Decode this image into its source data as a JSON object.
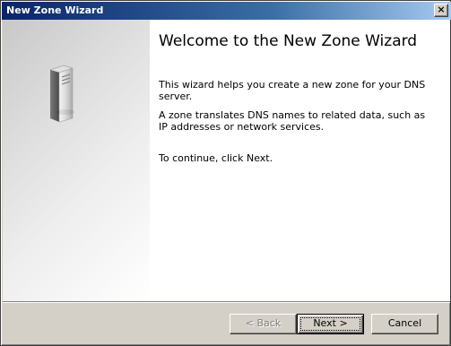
{
  "window": {
    "title": "New Zone Wizard",
    "close_glyph": "×"
  },
  "wizard": {
    "heading": "Welcome to the New Zone Wizard",
    "paragraphs": [
      "This wizard helps you create a new zone for your DNS server.",
      "A zone translates DNS names to related data, such as IP addresses or network services.",
      "To continue, click Next."
    ],
    "side_icon": "server-tower-icon"
  },
  "buttons": {
    "back": "< Back",
    "next": "Next >",
    "cancel": "Cancel",
    "back_enabled": false
  }
}
